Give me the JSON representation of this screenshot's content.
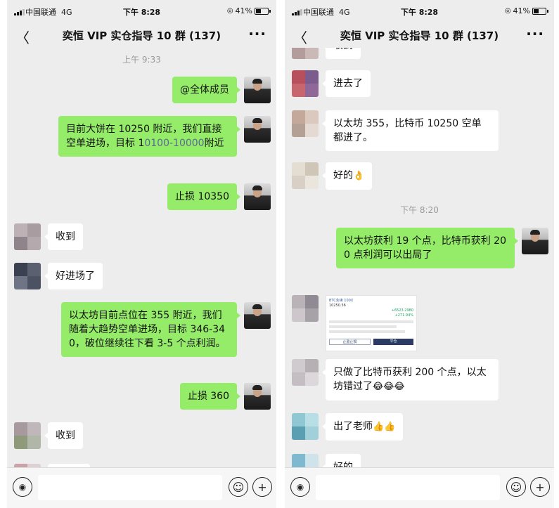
{
  "status": {
    "carrier": "中国联通",
    "network": "4G",
    "time": "下午 8:28",
    "battery": "41%"
  },
  "navbar": {
    "back": "〈",
    "title": "奕恒 VIP 实仓指导 10 群 (137)",
    "more": "···"
  },
  "left_screen": {
    "time_label": "上午 9:33",
    "messages": [
      {
        "text": "@全体成员"
      },
      {
        "text_a": "目前大饼在 10250 附近，我们直接空单进场，目标 1",
        "text_link": "0100-10000",
        "text_b": "附近"
      },
      {
        "text": "止损 10350"
      },
      {
        "text": "收到"
      },
      {
        "text": "好进场了"
      },
      {
        "text": "以太坊目前点位在 355 附近，我们随着大趋势空单进场，目标 346-340，破位继续往下看 3-5 个点利润。"
      },
      {
        "text": "止损 360"
      },
      {
        "text": "收到"
      }
    ]
  },
  "right_screen": {
    "time_label": "下午 8:20",
    "messages": [
      {
        "text": "收到"
      },
      {
        "text": "进去了"
      },
      {
        "text": "以太坊 355，比特币 10250 空单都进了。"
      },
      {
        "text": "好的",
        "emoji": "👌"
      },
      {
        "text": "以太坊获利 19 个点，比特币获利 200 点利润可以出局了"
      },
      {
        "text": "只做了比特币获利 200 个点，以太坊错过了",
        "emoji": "😂😂😂"
      },
      {
        "text": "出了老师",
        "emoji": "👍👍"
      },
      {
        "text": "好的"
      }
    ],
    "image_message": {
      "title": "BTC永续 100X",
      "value": "10250.56",
      "gain": "+6523.2980",
      "pct": "+271.94%",
      "btn_left": "止盈止损",
      "btn_right": "平仓"
    }
  },
  "inputbar": {
    "voice_icon": "voice-icon",
    "emoji_icon": "smiley-icon",
    "plus_icon": "plus-icon"
  },
  "colors": {
    "self_bubble": "#95ec69",
    "other_bubble": "#ffffff",
    "background": "#ededed",
    "link": "#576b95"
  }
}
